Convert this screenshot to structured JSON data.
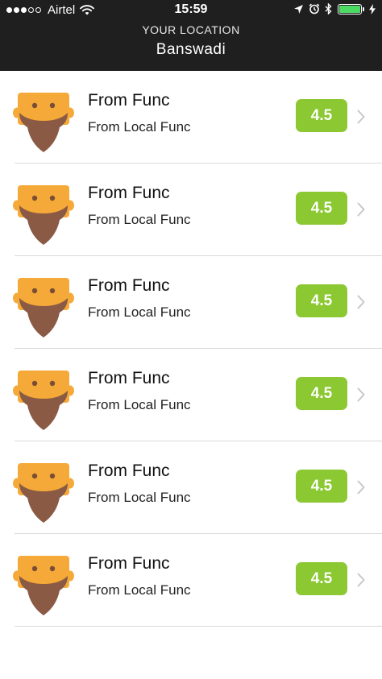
{
  "status": {
    "carrier": "Airtel",
    "time": "15:59",
    "signal_bars_filled": 3,
    "signal_bars_total": 5,
    "battery_level": 1
  },
  "header": {
    "label": "YOUR LOCATION",
    "location": "Banswadi"
  },
  "items": [
    {
      "title": "From Func",
      "subtitle": "From Local Func",
      "rating": "4.5",
      "icon": "bearded-man-avatar"
    },
    {
      "title": "From Func",
      "subtitle": "From Local Func",
      "rating": "4.5",
      "icon": "bearded-man-avatar"
    },
    {
      "title": "From Func",
      "subtitle": "From Local Func",
      "rating": "4.5",
      "icon": "bearded-man-avatar"
    },
    {
      "title": "From Func",
      "subtitle": "From Local Func",
      "rating": "4.5",
      "icon": "bearded-man-avatar"
    },
    {
      "title": "From Func",
      "subtitle": "From Local Func",
      "rating": "4.5",
      "icon": "bearded-man-avatar"
    },
    {
      "title": "From Func",
      "subtitle": "From Local Func",
      "rating": "4.5",
      "icon": "bearded-man-avatar"
    }
  ],
  "colors": {
    "header_bg": "#1f1f1f",
    "rating_bg": "#8bc832",
    "face": "#f5a938",
    "beard": "#8a5a44",
    "battery": "#4cd964"
  }
}
